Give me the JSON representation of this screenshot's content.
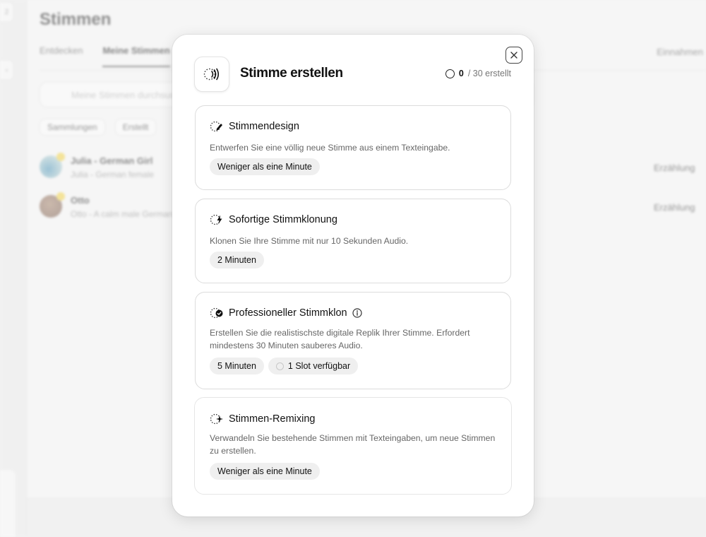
{
  "background": {
    "page_title": "Stimmen",
    "tabs": [
      "Entdecken",
      "Meine Stimmen"
    ],
    "right_tab": "Einnahmen",
    "search_placeholder": "Meine Stimmen durchsuchen",
    "filters": [
      "Sammlungen",
      "Erstellt"
    ],
    "rows": [
      {
        "name": "Julia - German Girl",
        "desc": "Julia - German female",
        "category": "Erzählung"
      },
      {
        "name": "Otto",
        "desc": "Otto - A calm male German",
        "category": "Erzählung"
      }
    ]
  },
  "modal": {
    "title": "Stimme erstellen",
    "counter": {
      "used": "0",
      "rest": "/ 30 erstellt"
    },
    "cards": [
      {
        "title": "Stimmendesign",
        "icon": "pen-sparkle-icon",
        "description": "Entwerfen Sie eine völlig neue Stimme aus einem Texteingabe.",
        "chips": [
          "Weniger als eine Minute"
        ]
      },
      {
        "title": "Sofortige Stimmklonung",
        "icon": "lightning-icon",
        "description": "Klonen Sie Ihre Stimme mit nur 10 Sekunden Audio.",
        "chips": [
          "2 Minuten"
        ]
      },
      {
        "title": "Professioneller Stimmklon",
        "icon": "badge-check-icon",
        "description": "Erstellen Sie die realistischste digitale Replik Ihrer Stimme. Erfordert mindestens 30 Minuten sauberes Audio.",
        "chips": [
          "5 Minuten",
          "1 Slot verfügbar"
        ]
      },
      {
        "title": "Stimmen-Remixing",
        "icon": "sparkle-icon",
        "description": "Verwandeln Sie bestehende Stimmen mit Texteingaben, um neue Stimmen zu erstellen.",
        "chips": [
          "Weniger als eine Minute"
        ]
      }
    ]
  }
}
